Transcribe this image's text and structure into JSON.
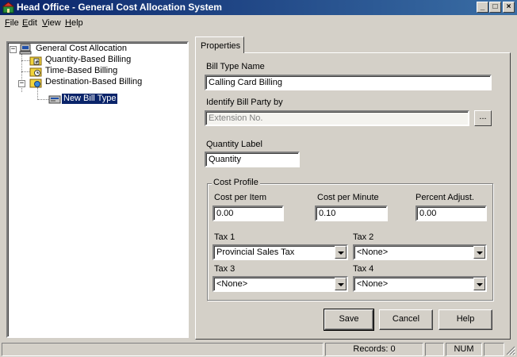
{
  "window": {
    "title": "Head Office - General Cost Allocation System",
    "controls": {
      "minimize": "_",
      "maximize": "□",
      "close": "×"
    }
  },
  "menu": [
    "File",
    "Edit",
    "View",
    "Help"
  ],
  "tree": {
    "root": "General Cost Allocation",
    "children": [
      "Quantity-Based Billing",
      "Time-Based Billing",
      "Destination-Based Billing"
    ],
    "grandchild": "New Bill Type"
  },
  "tab": {
    "label": "Properties"
  },
  "form": {
    "bill_type_name_label": "Bill Type Name",
    "bill_type_name_value": "Calling Card Billing",
    "identify_label": "Identify Bill Party by",
    "identify_value": "Extension No.",
    "browse_label": "...",
    "quantity_label_label": "Quantity Label",
    "quantity_label_value": "Quantity"
  },
  "cost_profile": {
    "title": "Cost Profile",
    "cost_per_item_label": "Cost per Item",
    "cost_per_item_value": "0.00",
    "cost_per_minute_label": "Cost per Minute",
    "cost_per_minute_value": "0.10",
    "percent_adjust_label": "Percent Adjust.",
    "percent_adjust_value": "0.00",
    "tax1_label": "Tax 1",
    "tax1_value": "Provincial Sales Tax",
    "tax2_label": "Tax 2",
    "tax2_value": "<None>",
    "tax3_label": "Tax 3",
    "tax3_value": "<None>",
    "tax4_label": "Tax 4",
    "tax4_value": "<None>"
  },
  "buttons": {
    "save": "Save",
    "cancel": "Cancel",
    "help": "Help"
  },
  "status": {
    "records": "Records: 0",
    "num": "NUM"
  },
  "colors": {
    "titlebar_start": "#0a246a",
    "titlebar_end": "#3a6ea5",
    "face": "#d4d0c8",
    "selection": "#0a246a"
  },
  "icons": [
    "app-icon",
    "computer-icon",
    "quantity-billing-icon",
    "time-billing-icon",
    "destination-billing-icon",
    "bill-type-icon",
    "size-grip-icon"
  ]
}
